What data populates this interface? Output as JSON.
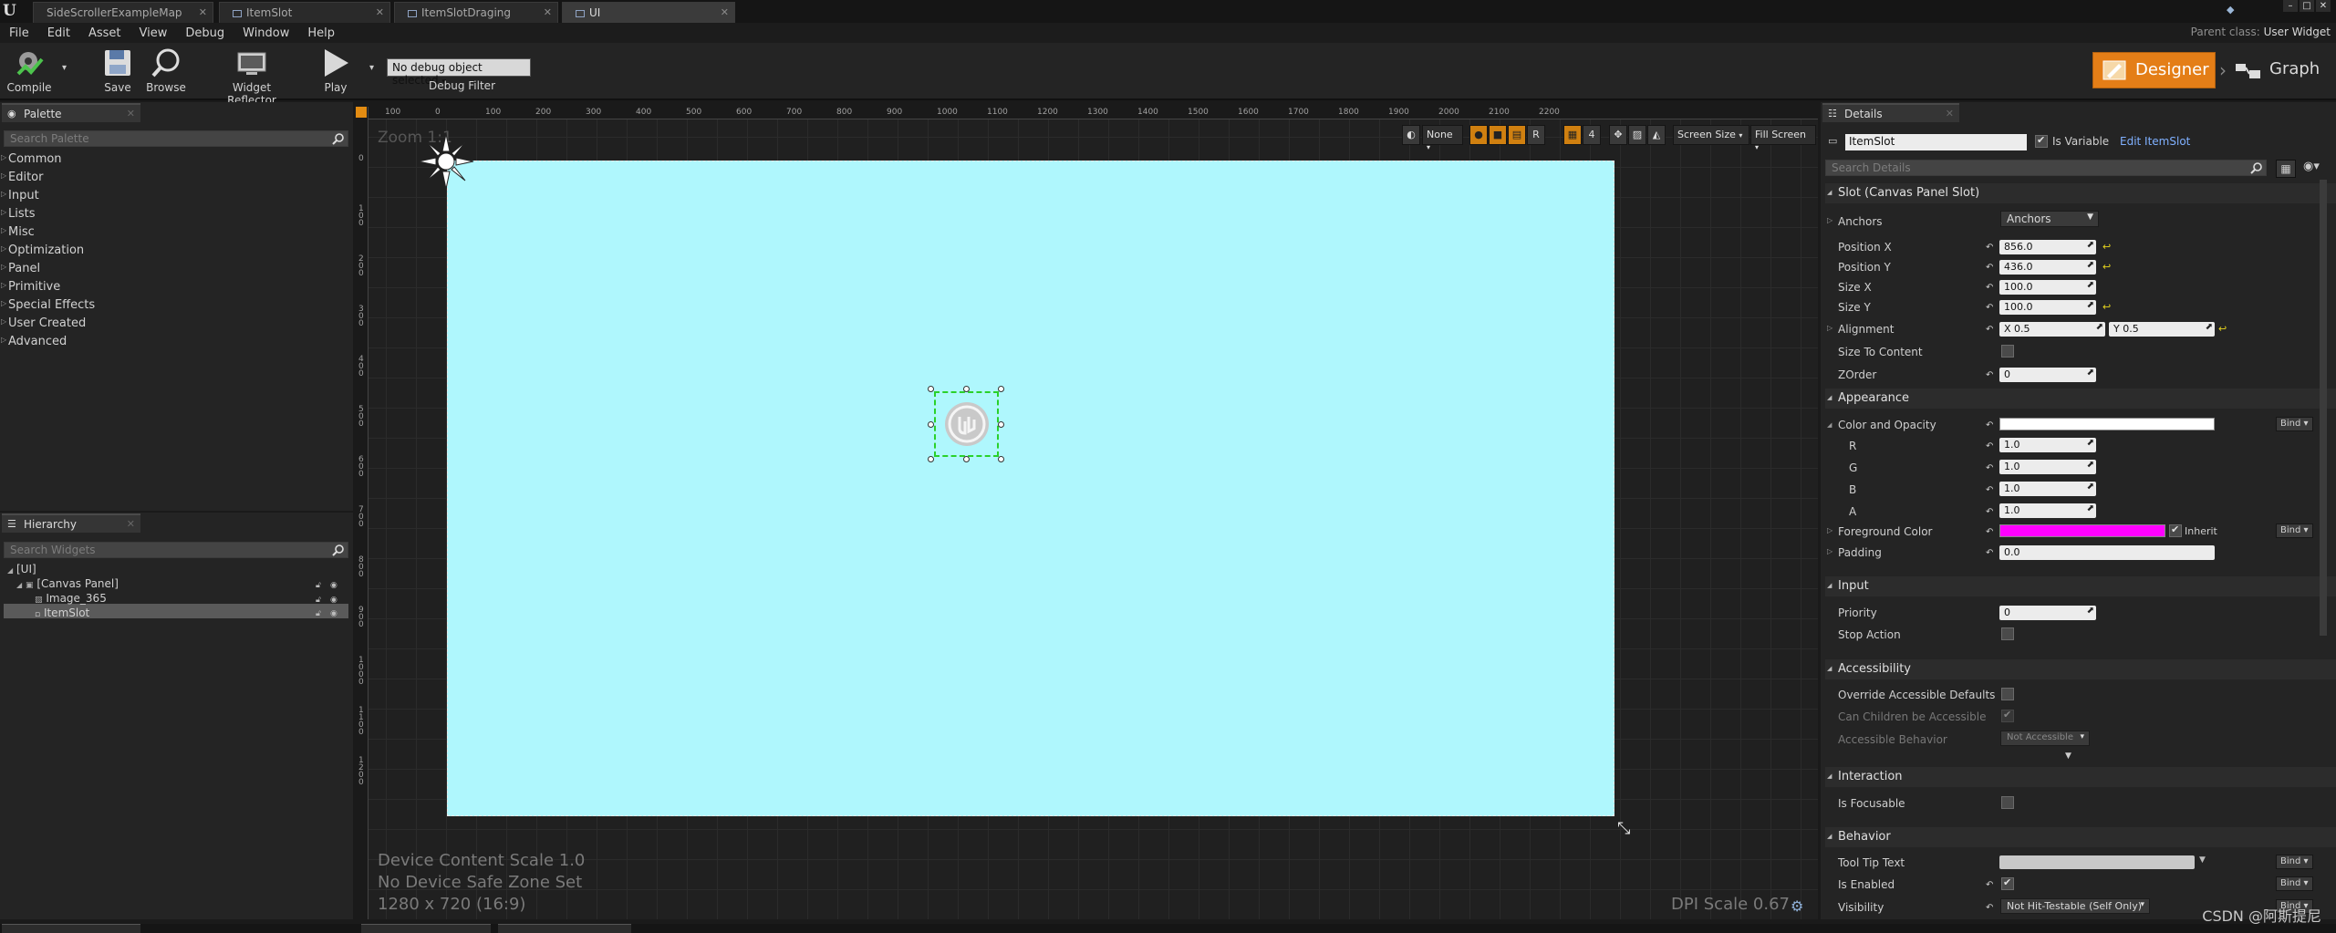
{
  "tabs": [
    {
      "label": "SideScrollerExampleMap",
      "active": false
    },
    {
      "label": "ItemSlot",
      "active": false
    },
    {
      "label": "ItemSlotDraging",
      "active": false
    },
    {
      "label": "UI",
      "active": true
    }
  ],
  "menu": [
    "File",
    "Edit",
    "Asset",
    "View",
    "Debug",
    "Window",
    "Help"
  ],
  "parent_class": {
    "label": "Parent class:",
    "value": "User Widget"
  },
  "toolbar": {
    "compile": "Compile",
    "save": "Save",
    "browse": "Browse",
    "widget_reflector": "Widget Reflector",
    "play": "Play",
    "debug_select": "No debug object selected",
    "debug_filter": "Debug Filter",
    "designer": "Designer",
    "graph": "Graph"
  },
  "palette": {
    "title": "Palette",
    "search_placeholder": "Search Palette",
    "categories": [
      "Common",
      "Editor",
      "Input",
      "Lists",
      "Misc",
      "Optimization",
      "Panel",
      "Primitive",
      "Special Effects",
      "User Created",
      "Advanced"
    ]
  },
  "hierarchy": {
    "title": "Hierarchy",
    "search_placeholder": "Search Widgets",
    "items": [
      "[UI]",
      "[Canvas Panel]",
      "Image_365",
      "ItemSlot"
    ]
  },
  "viewport": {
    "zoom": "Zoom 1:1",
    "ruler_top": [
      "100",
      "0",
      "100",
      "200",
      "300",
      "400",
      "500",
      "600",
      "700",
      "800",
      "900",
      "1000",
      "1100",
      "1200",
      "1300",
      "1400",
      "1500",
      "1600",
      "1700",
      "1800",
      "1900",
      "2000",
      "2100",
      "2200"
    ],
    "ruler_left": [
      "0",
      "100",
      "200",
      "300",
      "400",
      "500",
      "600",
      "700",
      "800",
      "900",
      "1000",
      "1100",
      "1200"
    ],
    "none_label": "None",
    "r_label": "R",
    "grid_size": "4",
    "screen_size": "Screen Size",
    "fill_screen": "Fill Screen",
    "device_scale": "Device Content Scale 1.0",
    "safe_zone": "No Device Safe Zone Set",
    "resolution": "1280 x 720 (16:9)",
    "dpi": "DPI Scale 0.67",
    "canvas_color": "#aff7fd"
  },
  "details": {
    "title": "Details",
    "name_value": "ItemSlot",
    "is_variable": "Is Variable",
    "edit_link": "Edit ItemSlot",
    "search_placeholder": "Search Details",
    "slot_section": "Slot (Canvas Panel Slot)",
    "anchors_label": "Anchors",
    "anchors_value": "Anchors",
    "position_x_label": "Position X",
    "position_x": "856.0",
    "position_y_label": "Position Y",
    "position_y": "436.0",
    "size_x_label": "Size X",
    "size_x": "100.0",
    "size_y_label": "Size Y",
    "size_y": "100.0",
    "alignment_label": "Alignment",
    "alignment_x": "X  0.5",
    "alignment_y": "Y  0.5",
    "size_to_content": "Size To Content",
    "zorder_label": "ZOrder",
    "zorder": "0",
    "appearance_section": "Appearance",
    "color_opacity": "Color and Opacity",
    "r_label": "R",
    "r": "1.0",
    "g_label": "G",
    "g": "1.0",
    "b_label": "B",
    "b": "1.0",
    "a_label": "A",
    "a": "1.0",
    "foreground_color": "Foreground Color",
    "foreground_hex": "#ff00ff",
    "inherit": "Inherit",
    "padding_label": "Padding",
    "padding": "0.0",
    "input_section": "Input",
    "priority_label": "Priority",
    "priority": "0",
    "stop_action": "Stop Action",
    "accessibility_section": "Accessibility",
    "override_accessible": "Override Accessible Defaults",
    "can_children": "Can Children be Accessible",
    "accessible_behavior": "Accessible Behavior",
    "accessible_behavior_value": "Not Accessible",
    "interaction_section": "Interaction",
    "is_focusable": "Is Focusable",
    "behavior_section": "Behavior",
    "tooltip_text": "Tool Tip Text",
    "is_enabled": "Is Enabled",
    "visibility_label": "Visibility",
    "visibility_value": "Not Hit-Testable (Self Only)",
    "bind": "Bind"
  },
  "watermark": "CSDN @阿斯提尼"
}
